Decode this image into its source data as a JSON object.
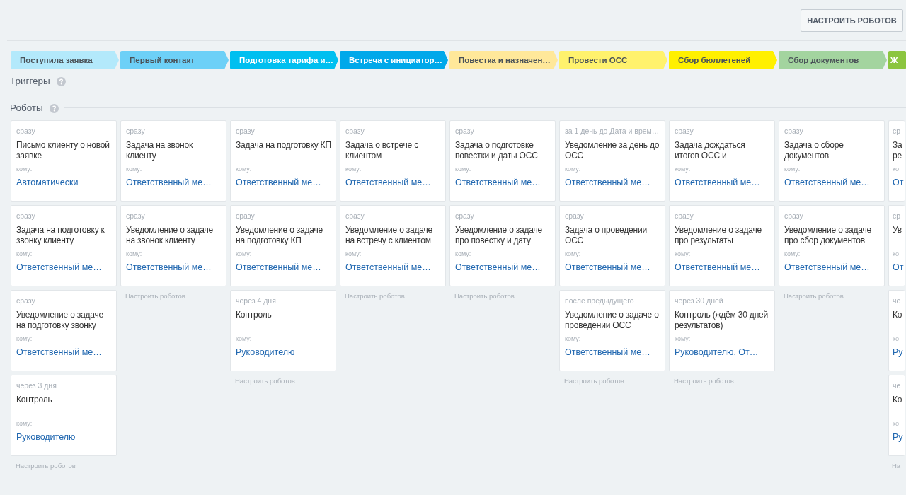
{
  "header": {
    "button": "НАСТРОИТЬ РОБОТОВ"
  },
  "stages": [
    {
      "label": "Поступила заявка",
      "color": "#b3e9fb"
    },
    {
      "label": "Первый контакт",
      "color": "#6dd0f7"
    },
    {
      "label": "Подготовка тарифа и…",
      "color": "#00bff0"
    },
    {
      "label": "Встреча с инициатор…",
      "color": "#00a8ea"
    },
    {
      "label": "Повестка и назначен…",
      "color": "#ffe89a"
    },
    {
      "label": "Провести ОСС",
      "color": "#fff26d"
    },
    {
      "label": "Сбор бюллетеней",
      "color": "#fff000"
    },
    {
      "label": "Сбор документов",
      "color": "#a3d49f"
    }
  ],
  "partial_stage": {
    "label": "Ж",
    "color": "#8bc53f"
  },
  "sections": [
    {
      "title": "Триггеры"
    },
    {
      "title": "Роботы"
    }
  ],
  "robots": {
    "columns": [
      {
        "cards": [
          {
            "timing": "сразу",
            "title": "Письмо клиенту о новой заявке",
            "to_label": "кому:",
            "recipient": "Автоматически"
          },
          {
            "timing": "сразу",
            "title": "Задача на подготовку к звонку клиенту",
            "to_label": "кому:",
            "recipient": "Ответственный ме…"
          },
          {
            "timing": "сразу",
            "title": "Уведомление о задаче на подготовку звонку",
            "to_label": "кому:",
            "recipient": "Ответственный ме…"
          },
          {
            "timing": "через 3 дня",
            "title": "Контроль",
            "to_label": "кому:",
            "recipient": "Руководителю"
          }
        ],
        "footer": "Настроить роботов"
      },
      {
        "cards": [
          {
            "timing": "сразу",
            "title": "Задача на звонок клиенту",
            "to_label": "кому:",
            "recipient": "Ответственный ме…"
          },
          {
            "timing": "сразу",
            "title": "Уведомление о задаче на звонок клиенту",
            "to_label": "кому:",
            "recipient": "Ответственный ме…"
          }
        ],
        "footer": "Настроить роботов"
      },
      {
        "cards": [
          {
            "timing": "сразу",
            "title": "Задача на подготовку КП",
            "to_label": "кому:",
            "recipient": "Ответственный ме…"
          },
          {
            "timing": "сразу",
            "title": "Уведомление о задаче на подготовку КП",
            "to_label": "кому:",
            "recipient": "Ответственный ме…"
          },
          {
            "timing": "через 4 дня",
            "title": "Контроль",
            "to_label": "кому:",
            "recipient": "Руководителю"
          }
        ],
        "footer": "Настроить роботов"
      },
      {
        "cards": [
          {
            "timing": "сразу",
            "title": "Задача о встрече с клиентом",
            "to_label": "кому:",
            "recipient": "Ответственный ме…"
          },
          {
            "timing": "сразу",
            "title": "Уведомление о задаче на встречу с клиентом",
            "to_label": "кому:",
            "recipient": "Ответственный ме…"
          }
        ],
        "footer": "Настроить роботов"
      },
      {
        "cards": [
          {
            "timing": "сразу",
            "title": "Задача о подготовке повестки и даты ОСС",
            "to_label": "кому:",
            "recipient": "Ответственный ме…"
          },
          {
            "timing": "сразу",
            "title": "Уведомление о задаче про повестку и дату",
            "to_label": "кому:",
            "recipient": "Ответственный ме…"
          }
        ],
        "footer": "Настроить роботов"
      },
      {
        "cards": [
          {
            "timing": "за 1 день до Дата и врем…",
            "title": "Уведомление за день до ОСС",
            "to_label": "кому:",
            "recipient": "Ответственный ме…"
          },
          {
            "timing": "сразу",
            "title": "Задача о проведении ОСС",
            "to_label": "кому:",
            "recipient": "Ответственный ме…"
          },
          {
            "timing": "после предыдущего",
            "title": "Уведомление о задаче о проведении ОСС",
            "to_label": "кому:",
            "recipient": "Ответственный ме…"
          }
        ],
        "footer": "Настроить роботов"
      },
      {
        "cards": [
          {
            "timing": "сразу",
            "title": "Задача дождаться итогов ОСС и",
            "to_label": "кому:",
            "recipient": "Ответственный ме…"
          },
          {
            "timing": "сразу",
            "title": "Уведомление о задаче про результаты",
            "to_label": "кому:",
            "recipient": "Ответственный ме…"
          },
          {
            "timing": "через 30 дней",
            "title": "Контроль (ждём 30 дней результатов)",
            "to_label": "кому:",
            "recipient": "Руководителю, От…"
          }
        ],
        "footer": "Настроить роботов"
      },
      {
        "cards": [
          {
            "timing": "сразу",
            "title": "Задача о сборе документов",
            "to_label": "кому:",
            "recipient": "Ответственный ме…"
          },
          {
            "timing": "сразу",
            "title": "Уведомление о задаче про сбор документов",
            "to_label": "кому:",
            "recipient": "Ответственный ме…"
          }
        ],
        "footer": "Настроить роботов"
      }
    ],
    "partial_column": {
      "cards": [
        {
          "timing": "ср",
          "title": "За ре",
          "to_label": "ко",
          "recipient": "От"
        },
        {
          "timing": "ср",
          "title": "Ув",
          "to_label": "ко",
          "recipient": "От"
        },
        {
          "timing": "че",
          "title": "Ко",
          "to_label": "ко",
          "recipient": "Ру"
        },
        {
          "timing": "че",
          "title": "Ко",
          "to_label": "ко",
          "recipient": "Ру"
        }
      ],
      "footer": "На"
    }
  }
}
